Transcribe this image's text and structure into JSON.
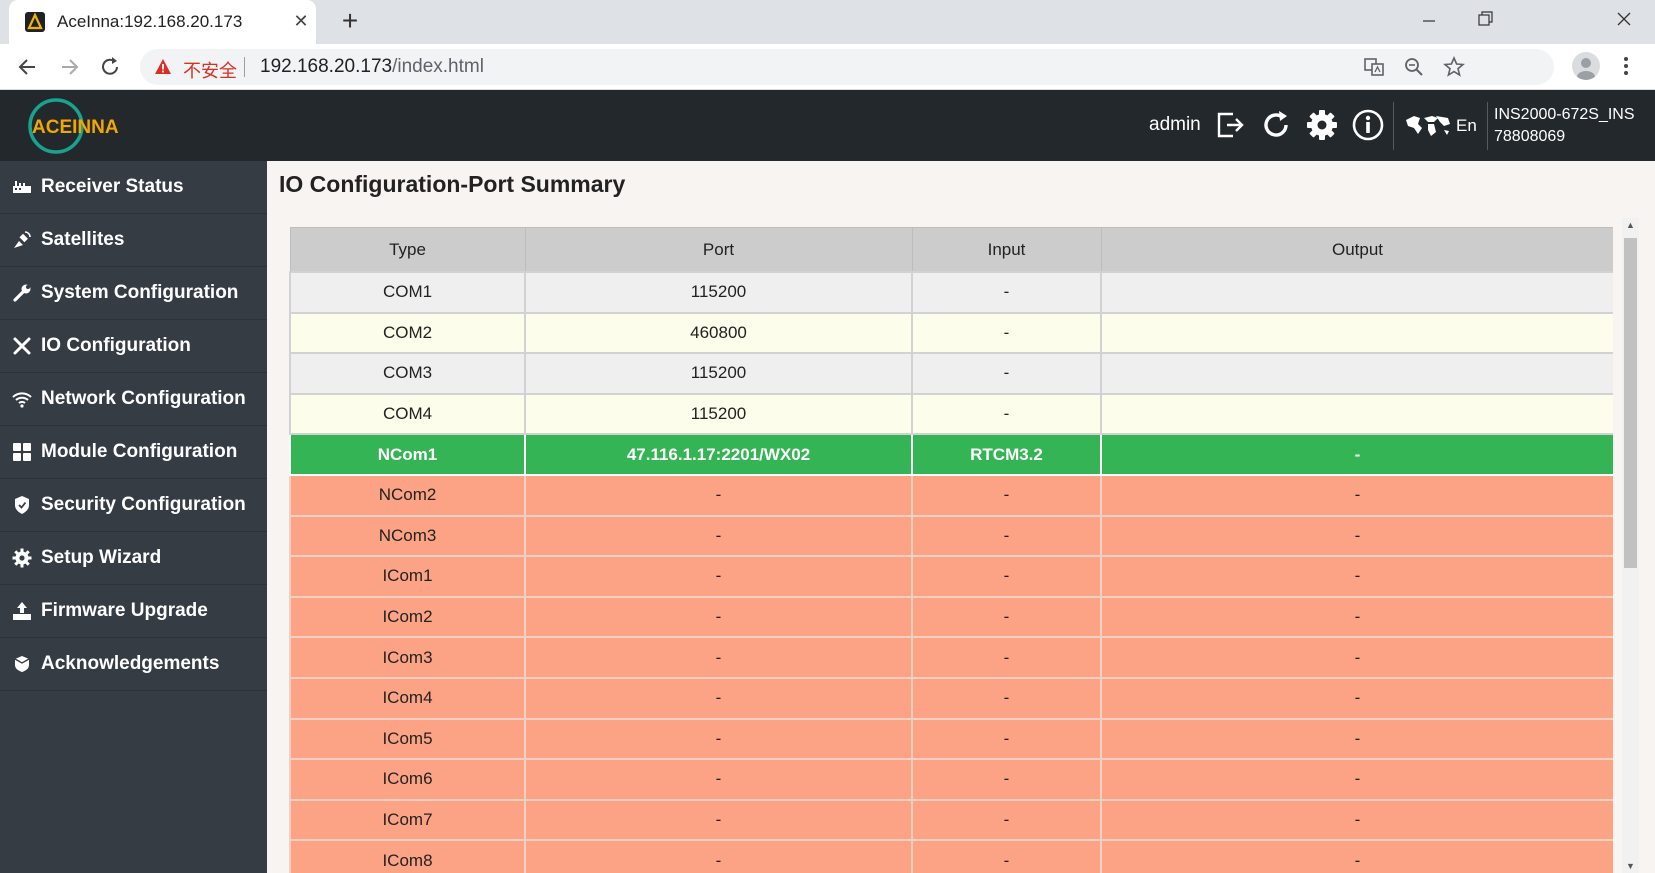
{
  "browser": {
    "tab_title": "AceInna:192.168.20.173",
    "tab_close": "✕",
    "new_tab": "+",
    "not_secure": "不安全",
    "url_host": "192.168.20.173",
    "url_path": "/index.html"
  },
  "header": {
    "logo_text": "ACEINNA",
    "user": "admin",
    "language": "En",
    "device_model": "INS2000-672S_INS",
    "device_serial": "78808069"
  },
  "sidebar": {
    "items": [
      {
        "label": "Receiver Status",
        "icon": "receiver-icon"
      },
      {
        "label": "Satellites",
        "icon": "satellite-icon"
      },
      {
        "label": "System Configuration",
        "icon": "wrench-icon"
      },
      {
        "label": "IO Configuration",
        "icon": "tools-icon"
      },
      {
        "label": "Network Configuration",
        "icon": "wifi-icon"
      },
      {
        "label": "Module Configuration",
        "icon": "grid-icon"
      },
      {
        "label": "Security Configuration",
        "icon": "shield-icon"
      },
      {
        "label": "Setup Wizard",
        "icon": "gear-icon"
      },
      {
        "label": "Firmware Upgrade",
        "icon": "upload-icon"
      },
      {
        "label": "Acknowledgements",
        "icon": "badge-icon"
      }
    ]
  },
  "main": {
    "title": "IO Configuration-Port Summary",
    "columns": [
      "Type",
      "Port",
      "Input",
      "Output"
    ],
    "rows": [
      {
        "type": "COM1",
        "port": "115200",
        "input": "-",
        "output": "",
        "status": "gray"
      },
      {
        "type": "COM2",
        "port": "460800",
        "input": "-",
        "output": "",
        "status": "cream"
      },
      {
        "type": "COM3",
        "port": "115200",
        "input": "-",
        "output": "",
        "status": "gray"
      },
      {
        "type": "COM4",
        "port": "115200",
        "input": "-",
        "output": "",
        "status": "cream"
      },
      {
        "type": "NCom1",
        "port": "47.116.1.17:2201/WX02",
        "input": "RTCM3.2",
        "output": "-",
        "status": "green"
      },
      {
        "type": "NCom2",
        "port": "-",
        "input": "-",
        "output": "-",
        "status": "salmon"
      },
      {
        "type": "NCom3",
        "port": "-",
        "input": "-",
        "output": "-",
        "status": "salmon"
      },
      {
        "type": "ICom1",
        "port": "-",
        "input": "-",
        "output": "-",
        "status": "salmon"
      },
      {
        "type": "ICom2",
        "port": "-",
        "input": "-",
        "output": "-",
        "status": "salmon"
      },
      {
        "type": "ICom3",
        "port": "-",
        "input": "-",
        "output": "-",
        "status": "salmon"
      },
      {
        "type": "ICom4",
        "port": "-",
        "input": "-",
        "output": "-",
        "status": "salmon"
      },
      {
        "type": "ICom5",
        "port": "-",
        "input": "-",
        "output": "-",
        "status": "salmon"
      },
      {
        "type": "ICom6",
        "port": "-",
        "input": "-",
        "output": "-",
        "status": "salmon"
      },
      {
        "type": "ICom7",
        "port": "-",
        "input": "-",
        "output": "-",
        "status": "salmon"
      },
      {
        "type": "ICom8",
        "port": "-",
        "input": "-",
        "output": "-",
        "status": "salmon"
      }
    ]
  },
  "colors": {
    "header_bg": "#23282d",
    "sidebar_bg": "#363c44",
    "active_row": "#34b455",
    "inactive_row": "#fba384",
    "accent_teal": "#18a38f"
  }
}
